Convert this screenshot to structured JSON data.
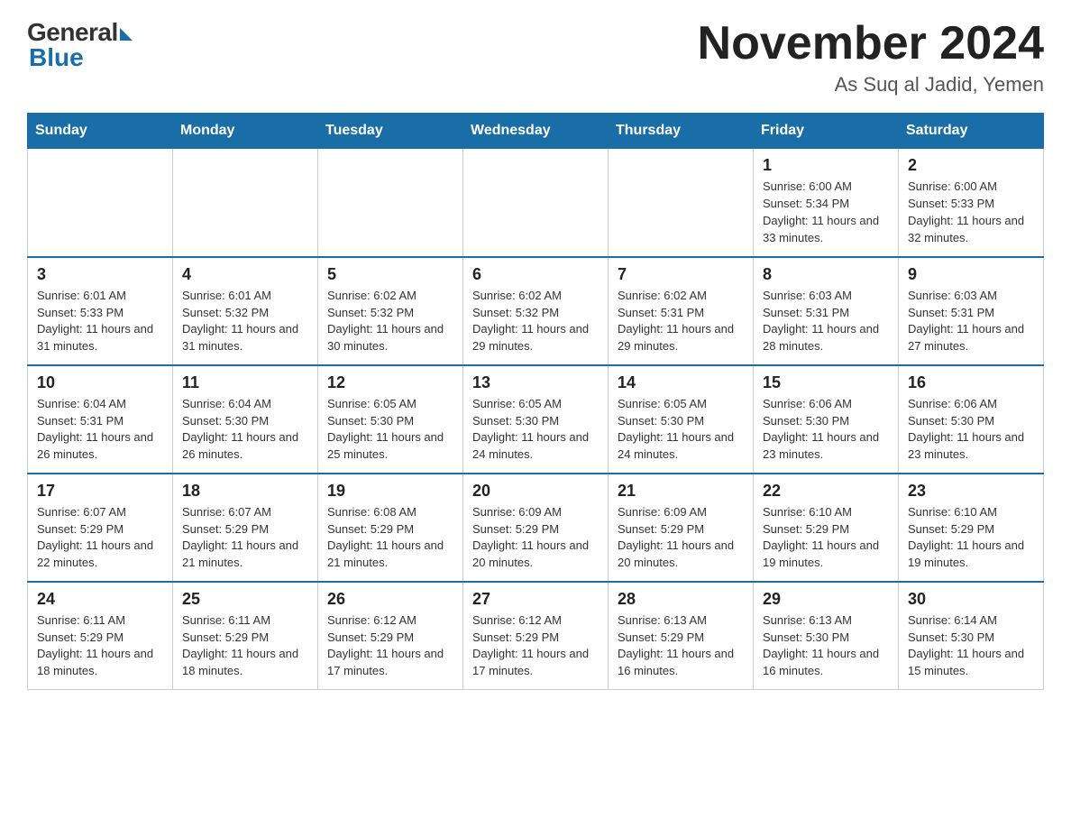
{
  "header": {
    "logo_general": "General",
    "logo_blue": "Blue",
    "calendar_title": "November 2024",
    "calendar_subtitle": "As Suq al Jadid, Yemen"
  },
  "weekdays": [
    "Sunday",
    "Monday",
    "Tuesday",
    "Wednesday",
    "Thursday",
    "Friday",
    "Saturday"
  ],
  "weeks": [
    [
      {
        "day": "",
        "info": ""
      },
      {
        "day": "",
        "info": ""
      },
      {
        "day": "",
        "info": ""
      },
      {
        "day": "",
        "info": ""
      },
      {
        "day": "",
        "info": ""
      },
      {
        "day": "1",
        "info": "Sunrise: 6:00 AM\nSunset: 5:34 PM\nDaylight: 11 hours and 33 minutes."
      },
      {
        "day": "2",
        "info": "Sunrise: 6:00 AM\nSunset: 5:33 PM\nDaylight: 11 hours and 32 minutes."
      }
    ],
    [
      {
        "day": "3",
        "info": "Sunrise: 6:01 AM\nSunset: 5:33 PM\nDaylight: 11 hours and 31 minutes."
      },
      {
        "day": "4",
        "info": "Sunrise: 6:01 AM\nSunset: 5:32 PM\nDaylight: 11 hours and 31 minutes."
      },
      {
        "day": "5",
        "info": "Sunrise: 6:02 AM\nSunset: 5:32 PM\nDaylight: 11 hours and 30 minutes."
      },
      {
        "day": "6",
        "info": "Sunrise: 6:02 AM\nSunset: 5:32 PM\nDaylight: 11 hours and 29 minutes."
      },
      {
        "day": "7",
        "info": "Sunrise: 6:02 AM\nSunset: 5:31 PM\nDaylight: 11 hours and 29 minutes."
      },
      {
        "day": "8",
        "info": "Sunrise: 6:03 AM\nSunset: 5:31 PM\nDaylight: 11 hours and 28 minutes."
      },
      {
        "day": "9",
        "info": "Sunrise: 6:03 AM\nSunset: 5:31 PM\nDaylight: 11 hours and 27 minutes."
      }
    ],
    [
      {
        "day": "10",
        "info": "Sunrise: 6:04 AM\nSunset: 5:31 PM\nDaylight: 11 hours and 26 minutes."
      },
      {
        "day": "11",
        "info": "Sunrise: 6:04 AM\nSunset: 5:30 PM\nDaylight: 11 hours and 26 minutes."
      },
      {
        "day": "12",
        "info": "Sunrise: 6:05 AM\nSunset: 5:30 PM\nDaylight: 11 hours and 25 minutes."
      },
      {
        "day": "13",
        "info": "Sunrise: 6:05 AM\nSunset: 5:30 PM\nDaylight: 11 hours and 24 minutes."
      },
      {
        "day": "14",
        "info": "Sunrise: 6:05 AM\nSunset: 5:30 PM\nDaylight: 11 hours and 24 minutes."
      },
      {
        "day": "15",
        "info": "Sunrise: 6:06 AM\nSunset: 5:30 PM\nDaylight: 11 hours and 23 minutes."
      },
      {
        "day": "16",
        "info": "Sunrise: 6:06 AM\nSunset: 5:30 PM\nDaylight: 11 hours and 23 minutes."
      }
    ],
    [
      {
        "day": "17",
        "info": "Sunrise: 6:07 AM\nSunset: 5:29 PM\nDaylight: 11 hours and 22 minutes."
      },
      {
        "day": "18",
        "info": "Sunrise: 6:07 AM\nSunset: 5:29 PM\nDaylight: 11 hours and 21 minutes."
      },
      {
        "day": "19",
        "info": "Sunrise: 6:08 AM\nSunset: 5:29 PM\nDaylight: 11 hours and 21 minutes."
      },
      {
        "day": "20",
        "info": "Sunrise: 6:09 AM\nSunset: 5:29 PM\nDaylight: 11 hours and 20 minutes."
      },
      {
        "day": "21",
        "info": "Sunrise: 6:09 AM\nSunset: 5:29 PM\nDaylight: 11 hours and 20 minutes."
      },
      {
        "day": "22",
        "info": "Sunrise: 6:10 AM\nSunset: 5:29 PM\nDaylight: 11 hours and 19 minutes."
      },
      {
        "day": "23",
        "info": "Sunrise: 6:10 AM\nSunset: 5:29 PM\nDaylight: 11 hours and 19 minutes."
      }
    ],
    [
      {
        "day": "24",
        "info": "Sunrise: 6:11 AM\nSunset: 5:29 PM\nDaylight: 11 hours and 18 minutes."
      },
      {
        "day": "25",
        "info": "Sunrise: 6:11 AM\nSunset: 5:29 PM\nDaylight: 11 hours and 18 minutes."
      },
      {
        "day": "26",
        "info": "Sunrise: 6:12 AM\nSunset: 5:29 PM\nDaylight: 11 hours and 17 minutes."
      },
      {
        "day": "27",
        "info": "Sunrise: 6:12 AM\nSunset: 5:29 PM\nDaylight: 11 hours and 17 minutes."
      },
      {
        "day": "28",
        "info": "Sunrise: 6:13 AM\nSunset: 5:29 PM\nDaylight: 11 hours and 16 minutes."
      },
      {
        "day": "29",
        "info": "Sunrise: 6:13 AM\nSunset: 5:30 PM\nDaylight: 11 hours and 16 minutes."
      },
      {
        "day": "30",
        "info": "Sunrise: 6:14 AM\nSunset: 5:30 PM\nDaylight: 11 hours and 15 minutes."
      }
    ]
  ]
}
